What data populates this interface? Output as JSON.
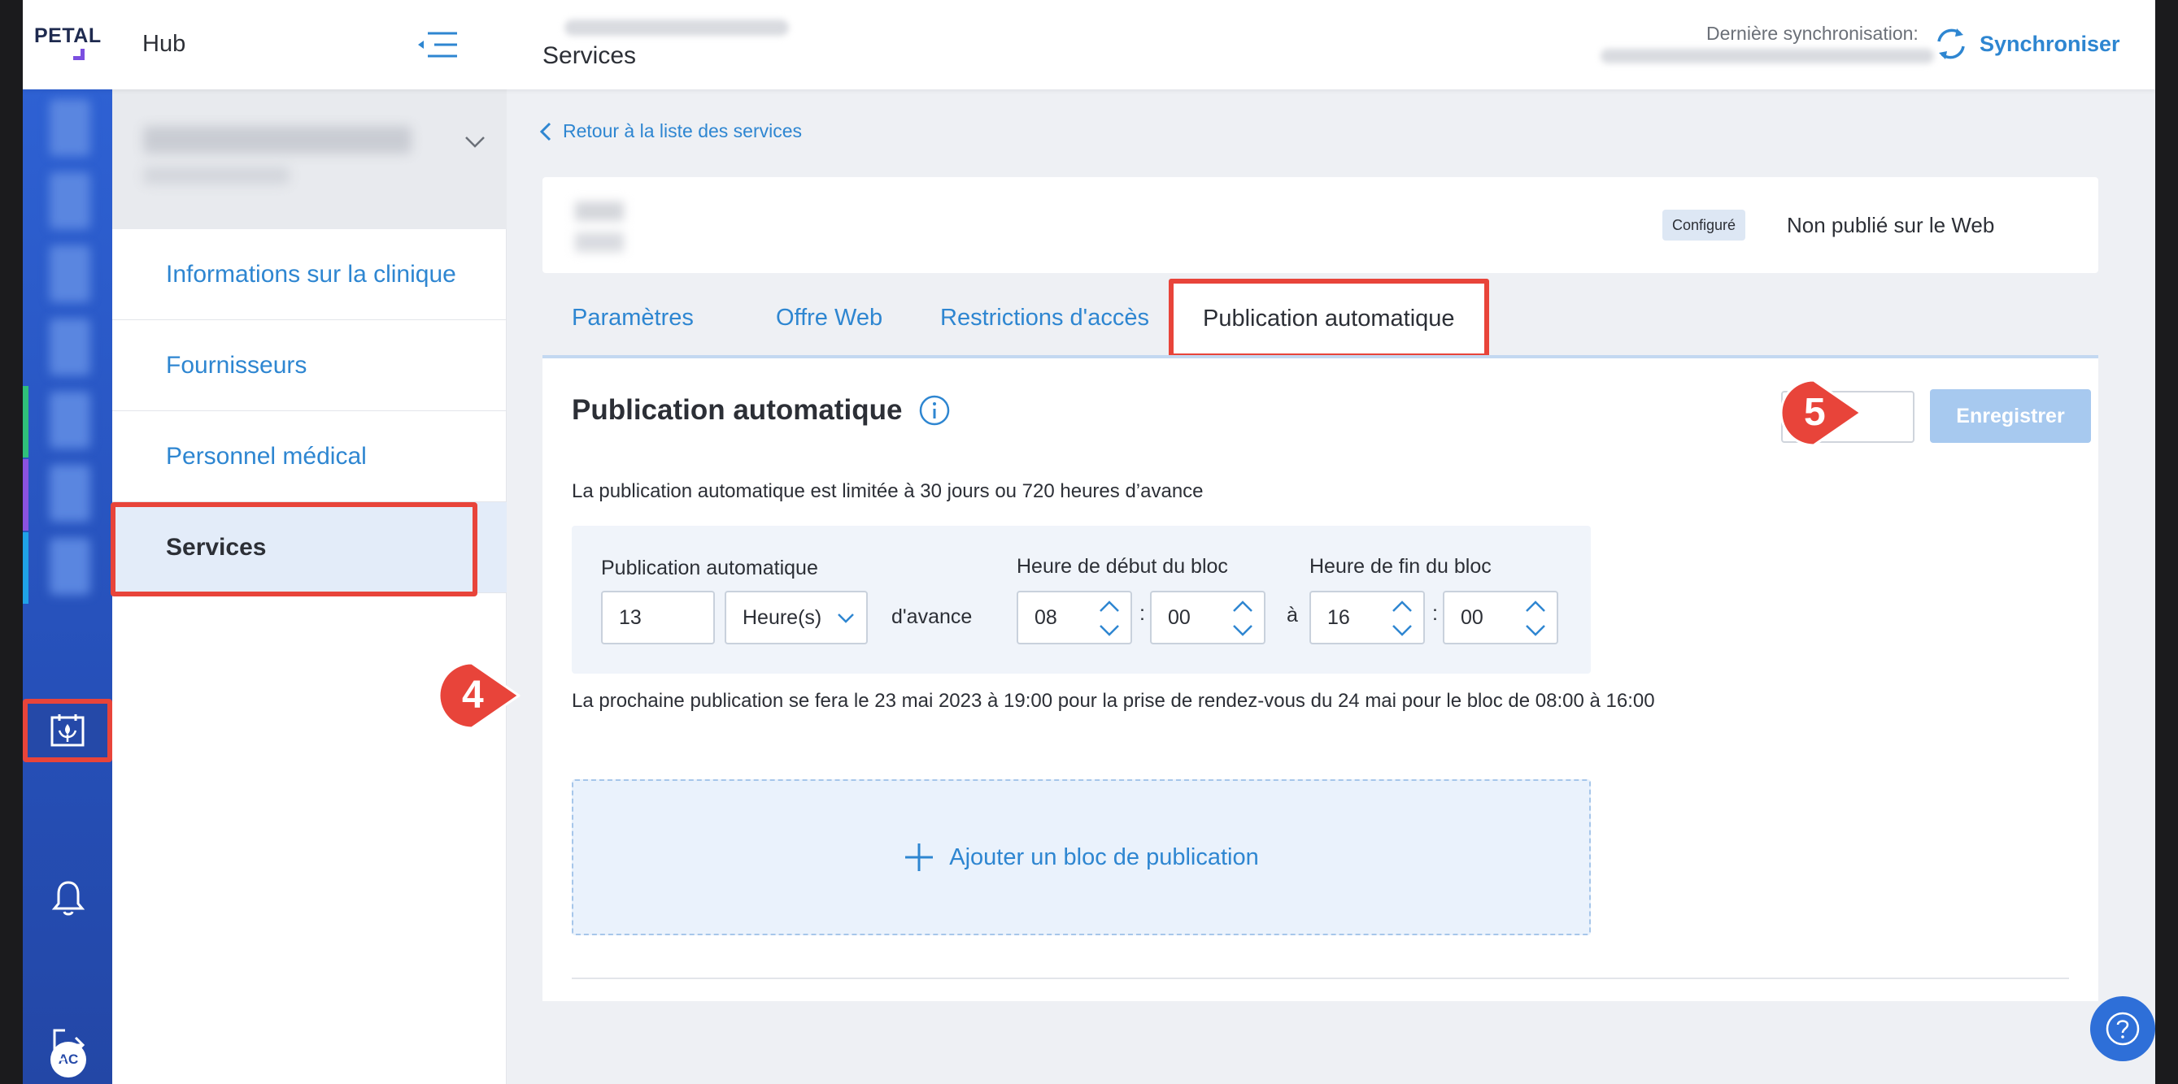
{
  "header": {
    "logo": "PETAL",
    "hub_label": "Hub",
    "page_title": "Services",
    "sync_label": "Dernière synchronisation:",
    "sync_button": "Synchroniser"
  },
  "rail": {
    "avatar_initials": "AC"
  },
  "sidebar": {
    "items": [
      {
        "label": "Informations sur la clinique"
      },
      {
        "label": "Fournisseurs"
      },
      {
        "label": "Personnel médical"
      },
      {
        "label": "Services"
      }
    ]
  },
  "main": {
    "back_link": "Retour à la liste des services",
    "service_status_badge": "Configuré",
    "web_status": "Non publié sur le Web",
    "tabs": [
      {
        "label": "Paramètres"
      },
      {
        "label": "Offre Web"
      },
      {
        "label": "Restrictions d'accès"
      },
      {
        "label": "Publication automatique"
      }
    ],
    "panel": {
      "title": "Publication automatique",
      "save_button": "Enregistrer",
      "limit_note": "La publication automatique est limitée à 30 jours ou 720 heures d’avance",
      "auto_pub_label": "Publication automatique",
      "auto_pub_value": "13",
      "unit_value": "Heure(s)",
      "advance_text": "d'avance",
      "start_label": "Heure de début du bloc",
      "start_hour": "08",
      "start_min": "00",
      "colon": ":",
      "to_text": "à",
      "end_label": "Heure de fin du bloc",
      "end_hour": "16",
      "end_min": "00",
      "next_publication": "La prochaine publication se fera le 23 mai 2023 à 19:00 pour la prise de rendez-vous du 24 mai pour le bloc de 08:00 à 16:00",
      "add_block": "Ajouter un bloc de publication"
    }
  },
  "callouts": {
    "step4": "4",
    "step5": "5"
  },
  "colors": {
    "accent": "#2e86d1",
    "highlight": "#e8443a",
    "rail": "#2650b9"
  }
}
